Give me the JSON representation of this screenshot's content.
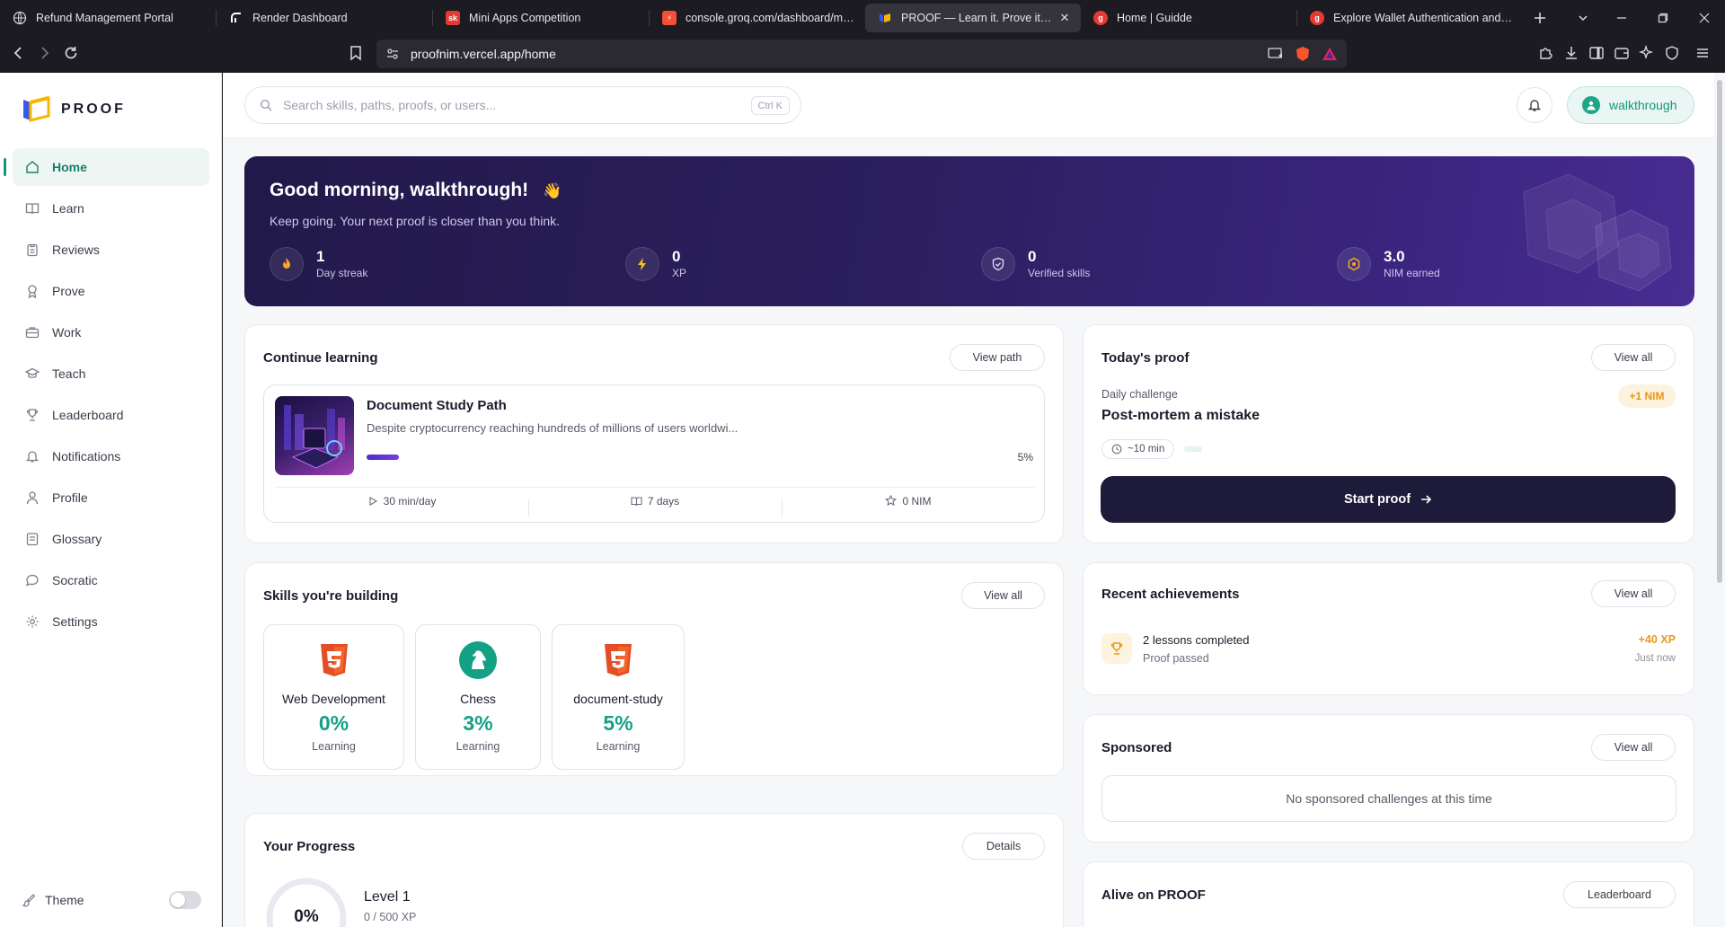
{
  "browser": {
    "tabs": [
      {
        "title": "Refund Management Portal",
        "favicon": "globe-icon",
        "color": "#555555"
      },
      {
        "title": "Render Dashboard",
        "favicon": "render-icon",
        "color": "#ffffff"
      },
      {
        "title": "Mini Apps Competition",
        "favicon": "sk-icon",
        "color": "#e53935"
      },
      {
        "title": "console.groq.com/dashboard/metrics",
        "favicon": "groq-icon",
        "color": "#f55036"
      },
      {
        "title": "PROOF — Learn it. Prove it. Earn it.",
        "favicon": "proof-icon",
        "color": "#f5b700",
        "active": true
      },
      {
        "title": "Home | Guidde",
        "favicon": "guidde-icon",
        "color": "#e53935"
      },
      {
        "title": "Explore Wallet Authentication and Identity",
        "favicon": "guidde-icon",
        "color": "#e53935"
      }
    ],
    "url": "proofnim.vercel.app/home"
  },
  "sidebar": {
    "brand": "PROOF",
    "items": [
      {
        "label": "Home",
        "icon": "home-icon",
        "active": true
      },
      {
        "label": "Learn",
        "icon": "book-icon"
      },
      {
        "label": "Reviews",
        "icon": "clipboard-icon"
      },
      {
        "label": "Prove",
        "icon": "badge-icon"
      },
      {
        "label": "Work",
        "icon": "briefcase-icon"
      },
      {
        "label": "Teach",
        "icon": "graduation-cap-icon"
      },
      {
        "label": "Leaderboard",
        "icon": "trophy-icon"
      },
      {
        "label": "Notifications",
        "icon": "bell-icon"
      },
      {
        "label": "Profile",
        "icon": "user-icon"
      },
      {
        "label": "Glossary",
        "icon": "book-open-icon"
      },
      {
        "label": "Socratic",
        "icon": "chat-icon"
      },
      {
        "label": "Settings",
        "icon": "gear-icon"
      }
    ],
    "theme_label": "Theme"
  },
  "topbar": {
    "search_placeholder": "Search skills, paths, proofs, or users...",
    "search_shortcut": "Ctrl K",
    "username": "walkthrough"
  },
  "hero": {
    "greeting": "Good morning, walkthrough!",
    "wave": "👋",
    "subtitle": "Keep going. Your next proof is closer than you think.",
    "stats": [
      {
        "value": "1",
        "label": "Day streak",
        "icon": "flame-icon"
      },
      {
        "value": "0",
        "label": "XP",
        "icon": "bolt-icon"
      },
      {
        "value": "0",
        "label": "Verified skills",
        "icon": "shield-check-icon"
      },
      {
        "value": "3.0",
        "label": "NIM earned",
        "icon": "nim-coin-icon"
      }
    ]
  },
  "continue_learning": {
    "title": "Continue learning",
    "action": "View path",
    "path": {
      "name": "Document Study Path",
      "description": "Despite cryptocurrency reaching hundreds of millions of users worldwi...",
      "progress_label": "5%",
      "progress": 0.05,
      "meta": [
        {
          "label": "30 min/day",
          "icon": "play-icon"
        },
        {
          "label": "7 days",
          "icon": "book-icon"
        },
        {
          "label": "0 NIM",
          "icon": "star-icon"
        }
      ]
    }
  },
  "todays_proof": {
    "title": "Today's proof",
    "action": "View all",
    "kicker": "Daily challenge",
    "challenge": "Post-mortem a mistake",
    "reward": "+1 NIM",
    "duration": "~10 min",
    "start_label": "Start proof"
  },
  "skills": {
    "title": "Skills you're building",
    "action": "View all",
    "items": [
      {
        "name": "Web Development",
        "percent": "0%",
        "status": "Learning",
        "icon": "html5-icon"
      },
      {
        "name": "Chess",
        "percent": "3%",
        "status": "Learning",
        "icon": "chess-knight-icon"
      },
      {
        "name": "document-study",
        "percent": "5%",
        "status": "Learning",
        "icon": "html5-icon"
      }
    ]
  },
  "achievements": {
    "title": "Recent achievements",
    "action": "View all",
    "items": [
      {
        "title": "2 lessons completed",
        "subtitle": "Proof passed",
        "xp": "+40 XP",
        "time": "Just now",
        "icon": "trophy-icon"
      }
    ]
  },
  "sponsored": {
    "title": "Sponsored",
    "action": "View all",
    "empty": "No sponsored challenges at this time"
  },
  "progress": {
    "title": "Your Progress",
    "action": "Details",
    "percent": "0%",
    "level": "Level 1",
    "xp": "0 / 500 XP"
  },
  "alive": {
    "title": "Alive on PROOF",
    "action": "Leaderboard"
  },
  "colors": {
    "accent": "#14967e",
    "hero": "#2b1f5e",
    "nim": "#e59a1c"
  }
}
